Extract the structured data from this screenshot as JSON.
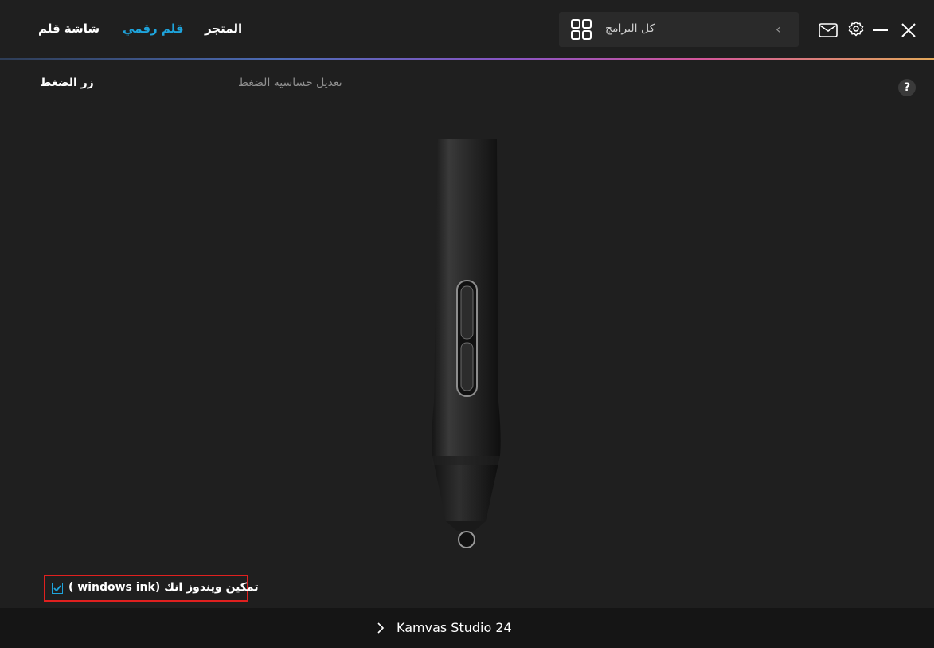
{
  "nav": {
    "pen_display": "شاشة قلم",
    "pen_tablet": "قلم رقمي",
    "store": "المتجر"
  },
  "search": {
    "label": "كل البرامج"
  },
  "tabs": {
    "press_key": "زر الضغط",
    "pressure_sensitivity": "تعديل حساسية الضغط"
  },
  "help": {
    "label": "?"
  },
  "windows_ink": {
    "label": "( windows ink) تمكين ويندوز انك",
    "checked": true
  },
  "footer": {
    "device_name": "Kamvas Studio 24"
  },
  "colors": {
    "background": "#1f1f1f",
    "accent": "#1ea4dc",
    "footer": "#151515",
    "highlight_border": "#e0201f"
  }
}
